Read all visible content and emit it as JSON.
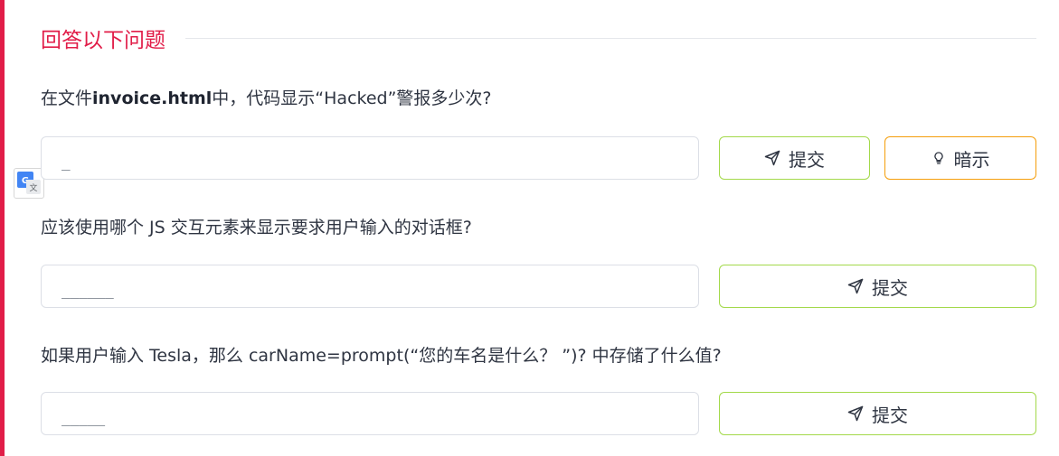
{
  "section": {
    "title": "回答以下问题"
  },
  "questions": [
    {
      "prefix": "在文件",
      "bold": "invoice.html",
      "suffix": "中，代码显示“Hacked”警报多少次?",
      "placeholder": "_",
      "submit_label": "提交",
      "hint_label": "暗示"
    },
    {
      "text": "应该使用哪个 JS 交互元素来显示要求用户输入的对话框?",
      "placeholder": "______",
      "submit_label": "提交"
    },
    {
      "text": "如果用户输入 Tesla，那么 carName=prompt(“您的车名是什么？ ”)? 中存储了什么值?",
      "placeholder": "_____",
      "submit_label": "提交"
    }
  ],
  "icons": {
    "submit": "paper-plane-icon",
    "hint": "lightbulb-icon",
    "translate": "google-translate-icon"
  },
  "colors": {
    "accent": "#e11d48",
    "submit_border": "#a3d94a",
    "hint_border": "#f59e0b"
  }
}
